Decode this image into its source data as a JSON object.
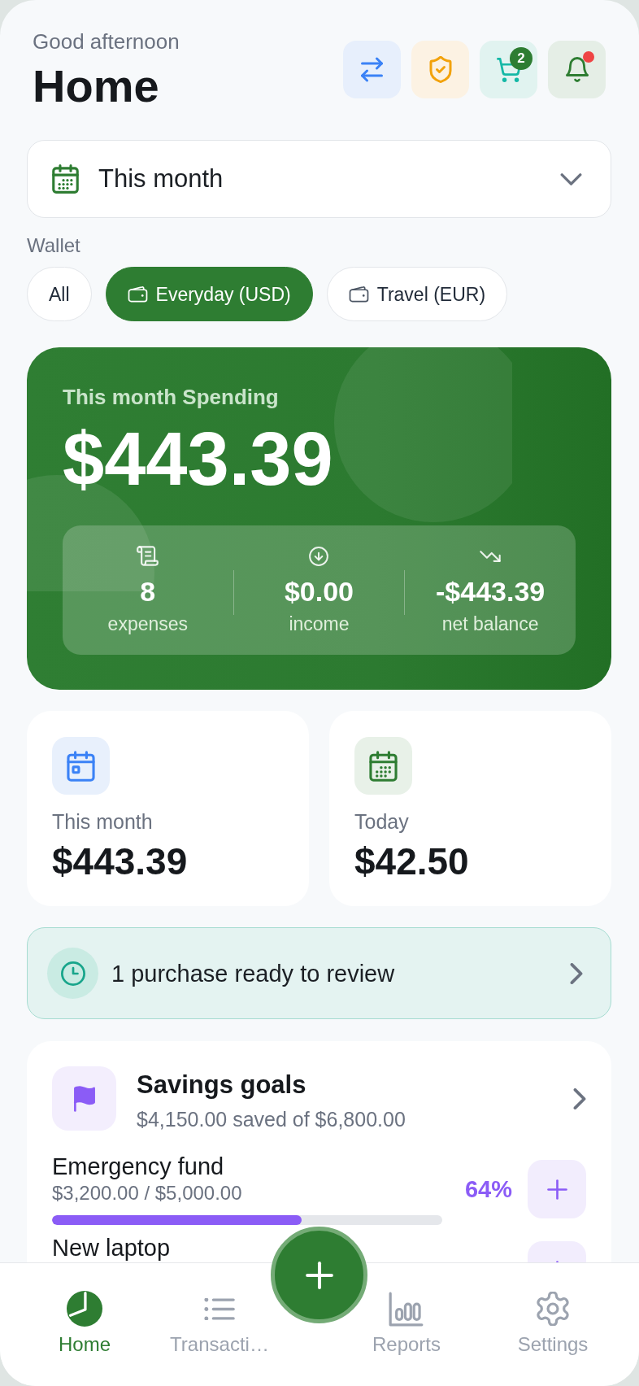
{
  "header": {
    "greeting": "Good afternoon",
    "title": "Home",
    "actions": [
      {
        "kind": "transfer"
      },
      {
        "kind": "security"
      },
      {
        "kind": "cart",
        "badge": "2"
      },
      {
        "kind": "notifications",
        "unread": true
      }
    ]
  },
  "period_select": {
    "value": "This month"
  },
  "wallet": {
    "label": "Wallet",
    "chips": [
      {
        "kind": "all",
        "label": "All",
        "selected": false
      },
      {
        "kind": "wallet",
        "label": "Everyday (USD)",
        "selected": true
      },
      {
        "kind": "wallet",
        "label": "Travel (EUR)",
        "selected": false
      }
    ]
  },
  "spending_card": {
    "label": "This month Spending",
    "amount": "$443.39",
    "stats": [
      {
        "kind": "expenses",
        "value": "8",
        "label": "expenses"
      },
      {
        "kind": "income",
        "value": "$0.00",
        "label": "income"
      },
      {
        "kind": "net",
        "value": "-$443.39",
        "label": "net balance"
      }
    ]
  },
  "summary_cards": [
    {
      "kind": "month",
      "label": "This month",
      "amount": "$443.39"
    },
    {
      "kind": "today",
      "label": "Today",
      "amount": "$42.50"
    }
  ],
  "review_banner": {
    "text": "1 purchase ready to review"
  },
  "savings_goals": {
    "title": "Savings goals",
    "summary": "$4,150.00 saved of $6,800.00",
    "goals": [
      {
        "name": "Emergency fund",
        "amounts": "$3,200.00 / $5,000.00",
        "percent": "64%",
        "level": 0.64
      },
      {
        "name": "New laptop"
      }
    ]
  },
  "bottom_nav": [
    {
      "kind": "home",
      "label": "Home",
      "selected": true
    },
    {
      "kind": "transactions",
      "label": "Transacti…",
      "selected": false
    },
    {
      "kind": "reports",
      "label": "Reports",
      "selected": false
    },
    {
      "kind": "settings",
      "label": "Settings",
      "selected": false
    }
  ]
}
